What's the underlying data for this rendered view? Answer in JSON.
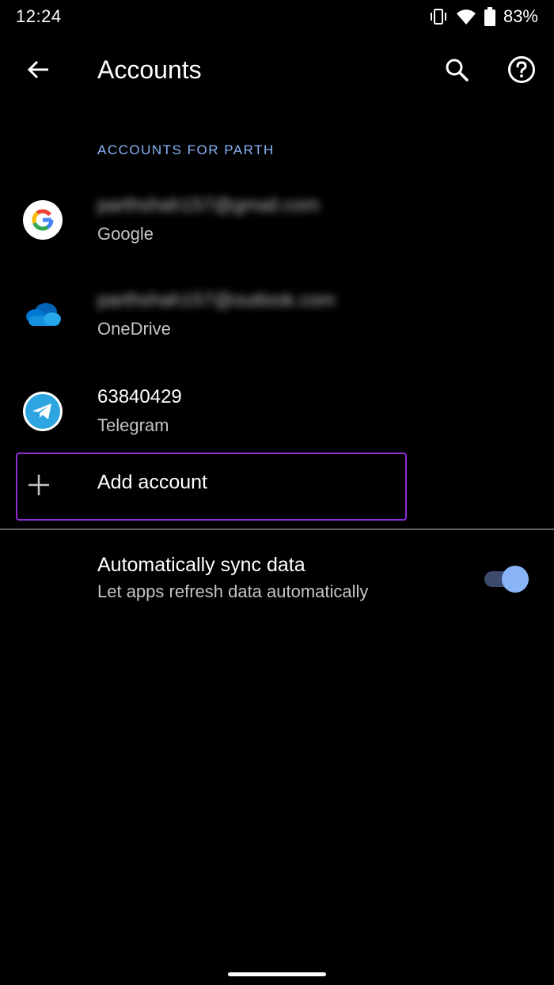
{
  "status_bar": {
    "time": "12:24",
    "battery_percent": "83%",
    "icons": [
      "vibrate-icon",
      "wifi-icon",
      "battery-icon"
    ]
  },
  "app_bar": {
    "title": "Accounts",
    "icons": [
      "back-arrow-icon",
      "search-icon",
      "help-icon"
    ]
  },
  "section": {
    "header": "ACCOUNTS FOR PARTH"
  },
  "accounts": [
    {
      "primary": "parthshah157@gmail.com",
      "secondary": "Google",
      "icon": "google-icon",
      "blurred": true
    },
    {
      "primary": "parthshah157@outlook.com",
      "secondary": "OneDrive",
      "icon": "onedrive-icon",
      "blurred": true
    },
    {
      "primary": "63840429",
      "secondary": "Telegram",
      "icon": "telegram-icon",
      "blurred": false
    }
  ],
  "add_account": {
    "label": "Add account",
    "icon": "plus-icon",
    "highlight_color": "#8e2fd6"
  },
  "sync": {
    "title": "Automatically sync data",
    "subtitle": "Let apps refresh data automatically",
    "enabled": true
  },
  "colors": {
    "background": "#000000",
    "accent": "#8ab4f8",
    "secondary_text": "#c4c4c4"
  }
}
